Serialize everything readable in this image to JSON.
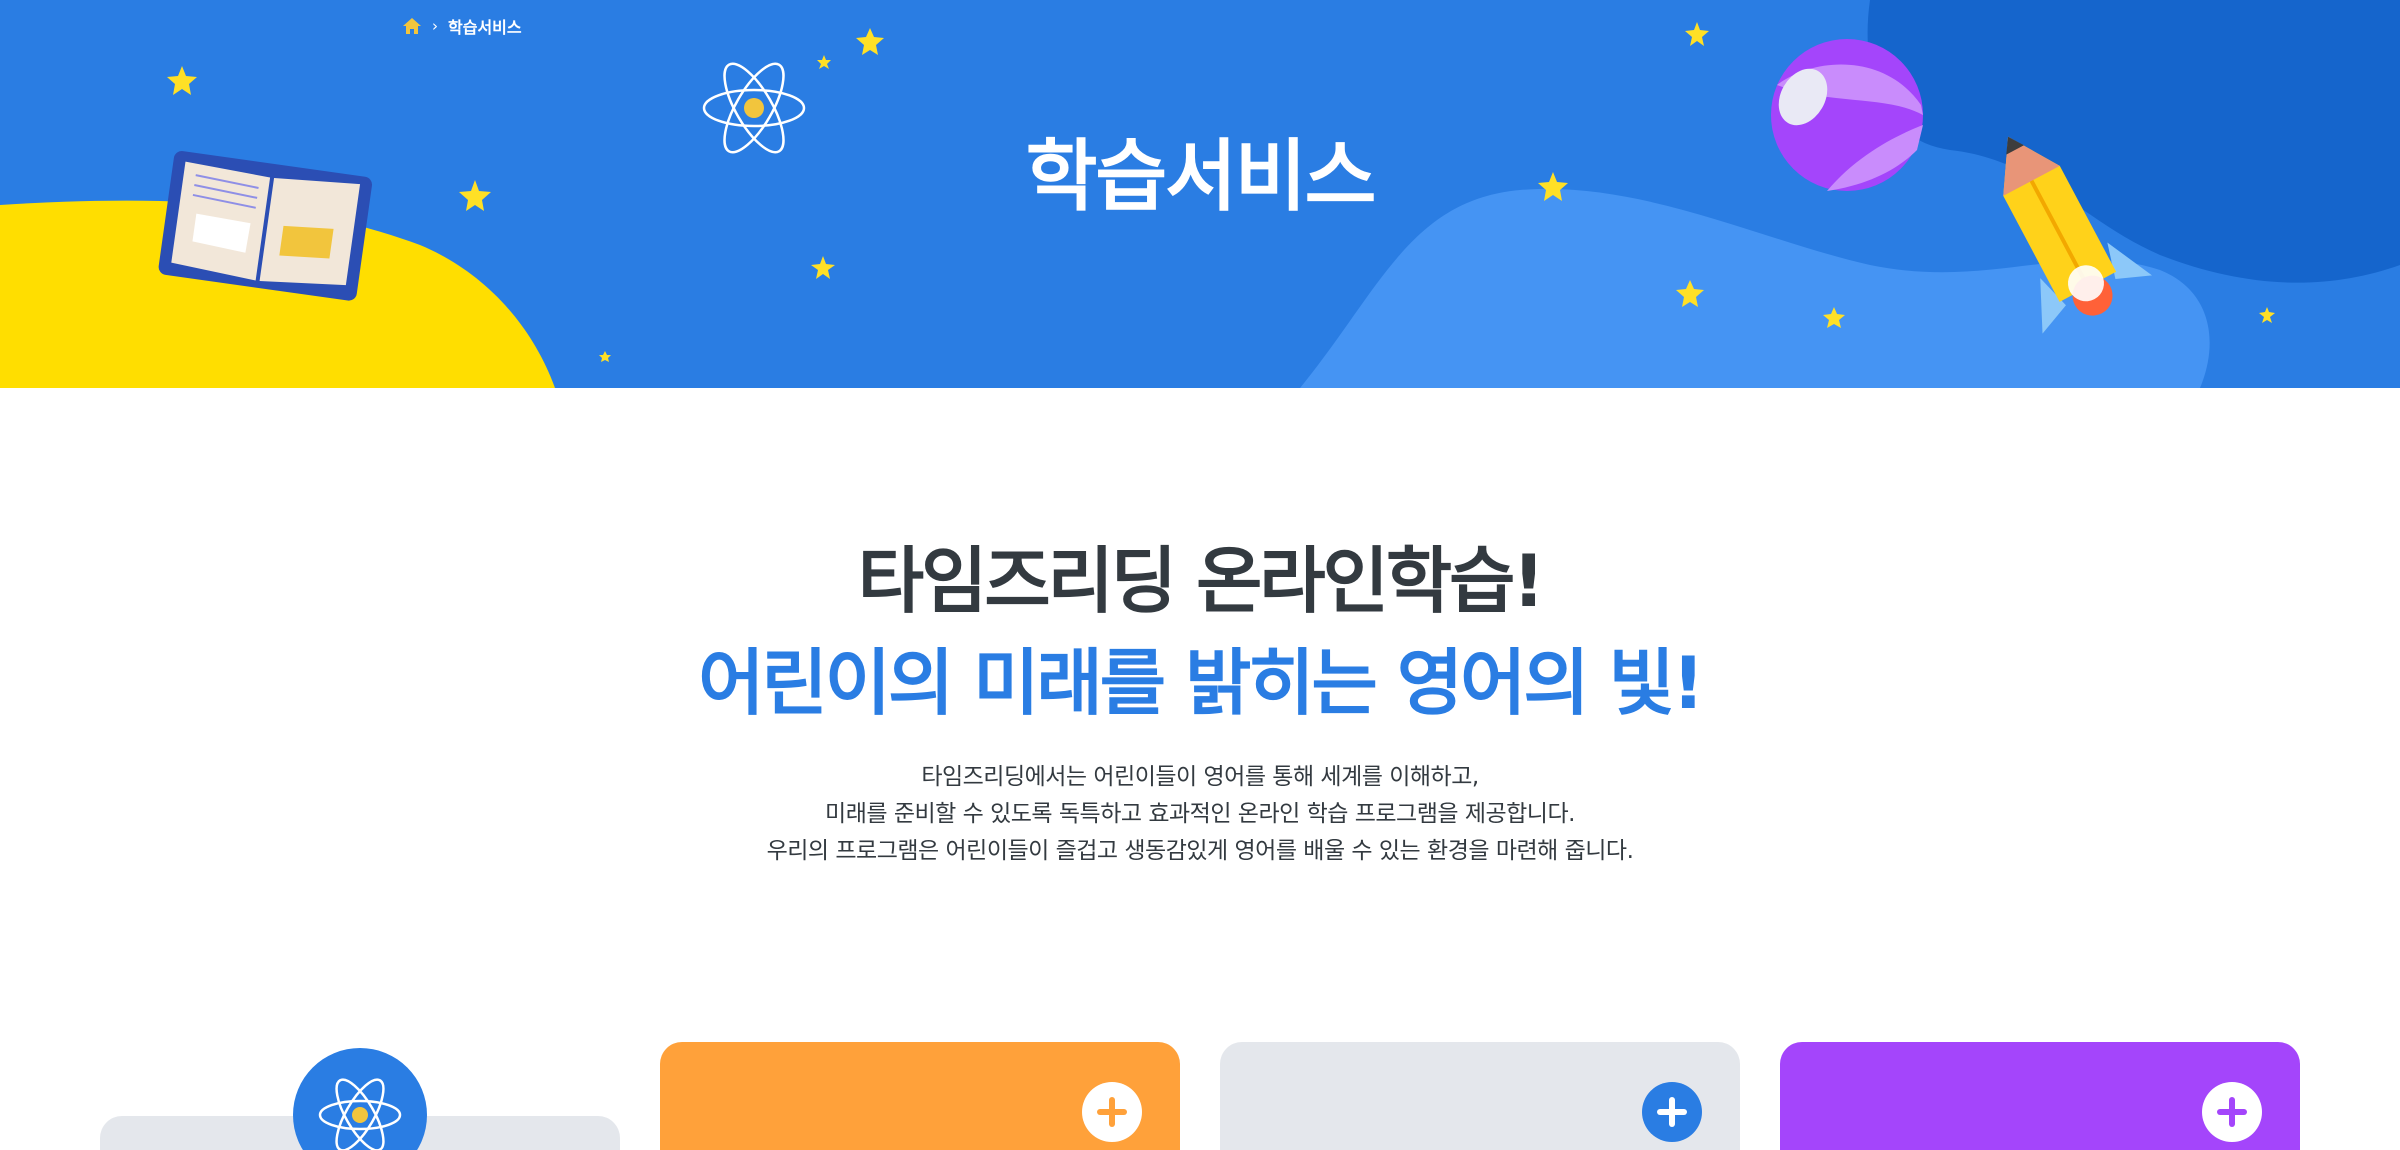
{
  "breadcrumb": {
    "home_icon": "home-icon",
    "separator_icon": "chevron-right-icon",
    "current": "학습서비스"
  },
  "hero": {
    "title": "학습서비스",
    "background_color": "#2a7de3",
    "decorations": [
      "open-book-icon",
      "atom-icon",
      "beach-ball-icon",
      "rocket-icon",
      "star-icon"
    ]
  },
  "intro": {
    "heading_line1": "타임즈리딩 온라인학습!",
    "heading_line2": "어린이의 미래를 밝히는 영어의 빛!",
    "description": [
      "타임즈리딩에서는 어린이들이 영어를 통해 세계를 이해하고,",
      "미래를 준비할 수 있도록 독특하고 효과적인 온라인 학습 프로그램을 제공합니다.",
      "우리의 프로그램은 어린이들이 즐겁고 생동감있게 영어를 배울 수 있는 환경을 마련해 줍니다."
    ],
    "heading_color": "#333a40",
    "accent_color": "#2a7de3"
  },
  "cards": [
    {
      "color": "#e4e7ec",
      "icon": "atom-icon",
      "badge_color": "#2a7de3"
    },
    {
      "color": "#ffa13a",
      "icon": "plus-circle-icon",
      "icon_color": "#ffa13a"
    },
    {
      "color": "#e4e7ec",
      "icon": "plus-circle-icon",
      "icon_color": "#2a7de3"
    },
    {
      "color": "#a445fb",
      "icon": "plus-circle-icon",
      "icon_color": "#a445fb"
    }
  ]
}
